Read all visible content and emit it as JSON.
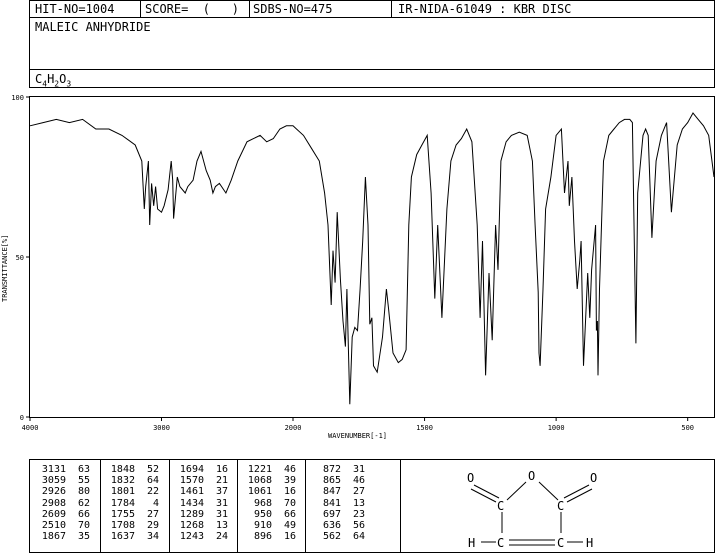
{
  "header": {
    "hit_no": "HIT-NO=1004",
    "score": "SCORE=  (   )",
    "sdbs_no": "SDBS-NO=475",
    "ir_nida": "IR-NIDA-61049 : KBR DISC",
    "compound": "MALEIC ANHYDRIDE",
    "formula": {
      "c": "C",
      "c_n": "4",
      "h": "H",
      "h_n": "2",
      "o": "O",
      "o_n": "3"
    }
  },
  "chart_data": {
    "type": "line",
    "xlabel": "WAVENUMBER[-1]",
    "ylabel": "TRANSMITTANCE[%]",
    "xlim": [
      4000,
      400
    ],
    "ylim": [
      0,
      100
    ],
    "x_reversed": true,
    "x_ticks": [
      "4000",
      "3000",
      "2000",
      "1500",
      "1000",
      "500"
    ],
    "x_tick_values": [
      4000,
      3000,
      2000,
      1500,
      1000,
      500
    ],
    "y_ticks": [
      "0",
      "50",
      "100"
    ],
    "y_tick_values": [
      0,
      50,
      100
    ],
    "series": [
      {
        "x": [
          4000,
          3900,
          3800,
          3700,
          3600,
          3500,
          3400,
          3300,
          3200,
          3150,
          3131,
          3120,
          3100,
          3090,
          3075,
          3059,
          3045,
          3030,
          3000,
          2980,
          2950,
          2926,
          2915,
          2908,
          2880,
          2860,
          2820,
          2800,
          2760,
          2730,
          2700,
          2660,
          2630,
          2609,
          2590,
          2560,
          2510,
          2470,
          2420,
          2350,
          2300,
          2250,
          2200,
          2150,
          2100,
          2050,
          2000,
          1960,
          1930,
          1900,
          1880,
          1867,
          1855,
          1848,
          1840,
          1832,
          1820,
          1810,
          1801,
          1795,
          1784,
          1775,
          1765,
          1755,
          1745,
          1735,
          1725,
          1715,
          1708,
          1700,
          1694,
          1680,
          1660,
          1645,
          1637,
          1620,
          1600,
          1585,
          1570,
          1560,
          1550,
          1530,
          1510,
          1490,
          1475,
          1461,
          1450,
          1434,
          1415,
          1400,
          1380,
          1360,
          1340,
          1320,
          1300,
          1289,
          1280,
          1268,
          1255,
          1243,
          1230,
          1221,
          1210,
          1190,
          1170,
          1140,
          1110,
          1090,
          1080,
          1068,
          1065,
          1061,
          1050,
          1040,
          1020,
          1000,
          980,
          968,
          955,
          950,
          940,
          930,
          920,
          910,
          905,
          896,
          880,
          872,
          865,
          850,
          847,
          843,
          841,
          835,
          820,
          800,
          780,
          760,
          740,
          720,
          710,
          697,
          690,
          670,
          660,
          650,
          636,
          620,
          600,
          580,
          562,
          540,
          520,
          500,
          480,
          460,
          440,
          420,
          400
        ],
        "y": [
          91,
          92,
          93,
          92,
          93,
          90,
          90,
          88,
          85,
          80,
          65,
          72,
          80,
          60,
          73,
          66,
          72,
          65,
          64,
          66,
          71,
          80,
          74,
          62,
          75,
          72,
          70,
          72,
          74,
          80,
          83,
          77,
          74,
          70,
          72,
          73,
          70,
          74,
          80,
          86,
          87,
          88,
          86,
          87,
          90,
          91,
          91,
          88,
          84,
          80,
          70,
          60,
          35,
          52,
          42,
          64,
          43,
          30,
          22,
          40,
          4,
          25,
          28,
          27,
          40,
          55,
          75,
          60,
          29,
          31,
          16,
          14,
          25,
          40,
          34,
          20,
          17,
          18,
          21,
          60,
          75,
          82,
          85,
          88,
          70,
          37,
          60,
          31,
          65,
          80,
          85,
          87,
          90,
          86,
          60,
          31,
          55,
          13,
          45,
          24,
          60,
          46,
          80,
          86,
          88,
          89,
          88,
          80,
          60,
          39,
          20,
          16,
          40,
          65,
          75,
          88,
          90,
          70,
          80,
          66,
          75,
          55,
          40,
          49,
          55,
          16,
          45,
          31,
          46,
          60,
          27,
          30,
          13,
          40,
          80,
          88,
          90,
          92,
          93,
          93,
          92,
          23,
          70,
          88,
          90,
          88,
          56,
          80,
          88,
          92,
          64,
          85,
          90,
          92,
          95,
          93,
          91,
          88,
          75
        ]
      }
    ],
    "peak_table": [
      [
        [
          "3131",
          "63"
        ],
        [
          "3059",
          "55"
        ],
        [
          "2926",
          "80"
        ],
        [
          "2908",
          "62"
        ],
        [
          "2609",
          "66"
        ],
        [
          "2510",
          "70"
        ],
        [
          "1867",
          "35"
        ]
      ],
      [
        [
          "1848",
          "52"
        ],
        [
          "1832",
          "64"
        ],
        [
          "1801",
          "22"
        ],
        [
          "1784",
          "4"
        ],
        [
          "1755",
          "27"
        ],
        [
          "1708",
          "29"
        ],
        [
          "1637",
          "34"
        ]
      ],
      [
        [
          "1694",
          "16"
        ],
        [
          "1570",
          "21"
        ],
        [
          "1461",
          "37"
        ],
        [
          "1434",
          "31"
        ],
        [
          "1289",
          "31"
        ],
        [
          "1268",
          "13"
        ],
        [
          "1243",
          "24"
        ]
      ],
      [
        [
          "1221",
          "46"
        ],
        [
          "1068",
          "39"
        ],
        [
          "1061",
          "16"
        ],
        [
          "968",
          "70"
        ],
        [
          "950",
          "66"
        ],
        [
          "910",
          "49"
        ],
        [
          "896",
          "16"
        ]
      ],
      [
        [
          "872",
          "31"
        ],
        [
          "865",
          "46"
        ],
        [
          "847",
          "27"
        ],
        [
          "841",
          "13"
        ],
        [
          "697",
          "23"
        ],
        [
          "636",
          "56"
        ],
        [
          "562",
          "64"
        ]
      ]
    ]
  },
  "structure": {
    "atom_o_left": "O",
    "atom_o_ring": "O",
    "atom_o_right": "O",
    "atom_c_left": "C",
    "atom_c_right": "C",
    "atom_ch_left": "C",
    "atom_ch_right": "C",
    "atom_h_left": "H",
    "atom_h_right": "H"
  }
}
